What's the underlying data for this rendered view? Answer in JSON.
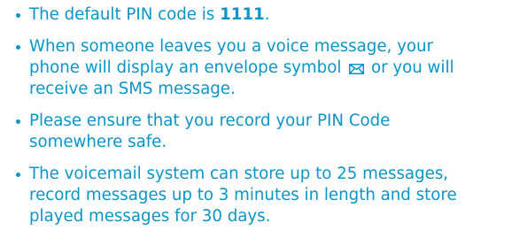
{
  "bullets": [
    {
      "before": "The default PIN code is ",
      "pin": "1111",
      "after": "."
    },
    {
      "line1": "When someone leaves you a voice message, your",
      "line2_before": "phone will display an envelope symbol ",
      "icon": "envelope-icon",
      "line2_after": " or you will",
      "line3": "receive an SMS message."
    },
    {
      "line1": "Please ensure that you record your PIN Code",
      "line2": "somewhere safe."
    },
    {
      "line1": "The voicemail system can store up to 25 messages,",
      "line2": "record messages up to 3 minutes in length and store",
      "line3": "played messages for 30 days."
    }
  ],
  "colors": {
    "text": "#0a95c8"
  }
}
